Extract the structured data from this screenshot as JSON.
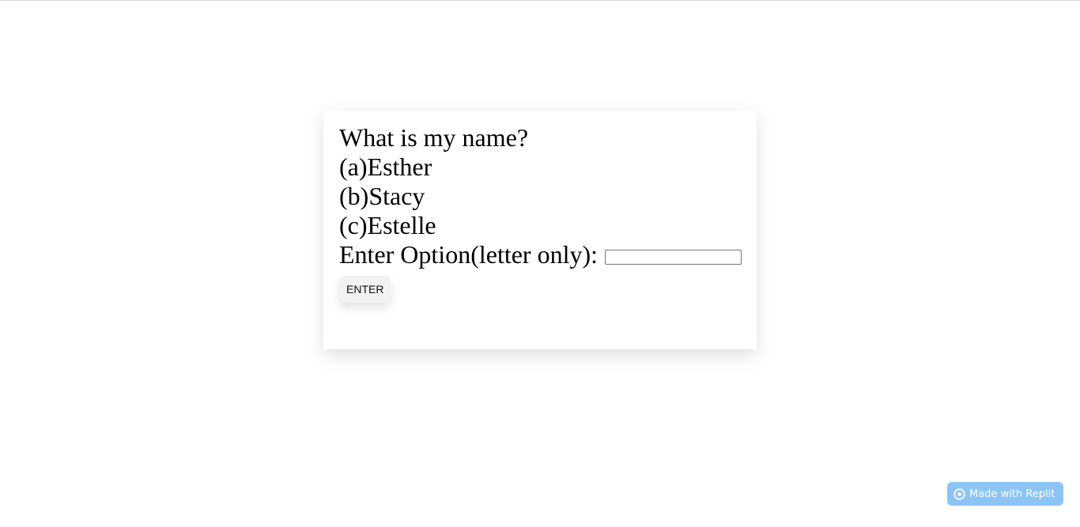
{
  "quiz": {
    "question": "What is my name?",
    "options": [
      "(a)Esther",
      "(b)Stacy",
      "(c)Estelle"
    ],
    "answer_label": "Enter Option(letter only):",
    "answer_value": "",
    "submit_label": "ENTER"
  },
  "badge": {
    "label": "Made with Replit",
    "icon": "replit-icon"
  },
  "colors": {
    "badge_background": "#8cc4f5",
    "text": "#000000"
  }
}
